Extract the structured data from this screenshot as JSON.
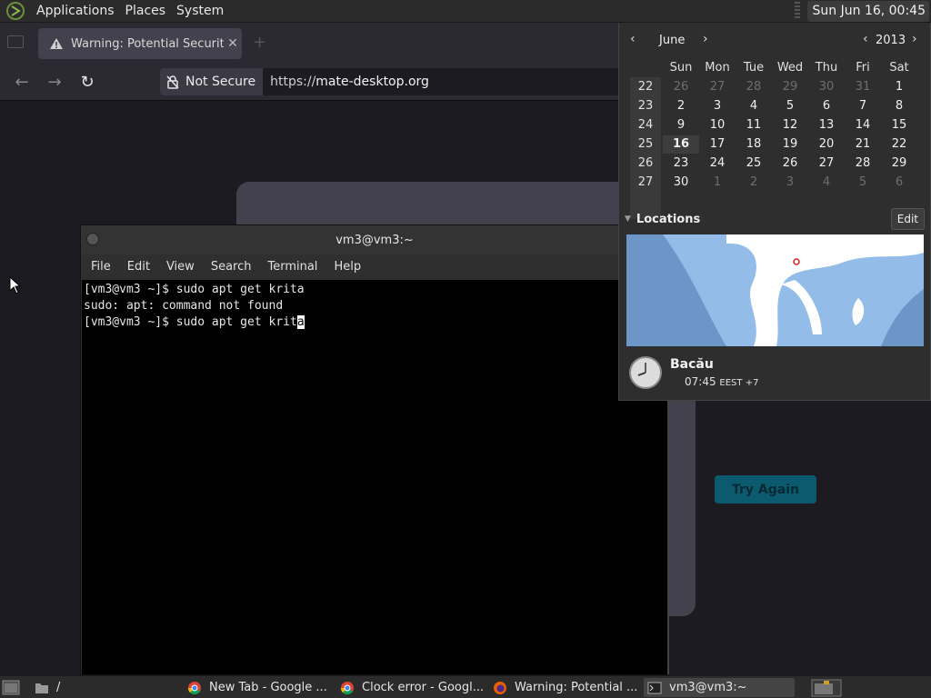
{
  "top_panel": {
    "menus": [
      "Applications",
      "Places",
      "System"
    ],
    "clock": "Sun Jun 16, 00:45"
  },
  "browser": {
    "tab_title": "Warning: Potential Security",
    "tab_close": "✕",
    "security_label": "Not Secure",
    "url_scheme": "https://",
    "url_host": "mate-desktop.org",
    "try_again_label": "Try Again"
  },
  "terminal": {
    "title": "vm3@vm3:~",
    "menu": [
      "File",
      "Edit",
      "View",
      "Search",
      "Terminal",
      "Help"
    ],
    "lines": [
      "[vm3@vm3 ~]$ sudo apt get krita",
      "sudo: apt: command not found"
    ],
    "current_prompt": "[vm3@vm3 ~]$ sudo apt get krit",
    "cursor_char": "a"
  },
  "calendar": {
    "month": "June",
    "year": "2013",
    "weekdays": [
      "Sun",
      "Mon",
      "Tue",
      "Wed",
      "Thu",
      "Fri",
      "Sat"
    ],
    "weeks": [
      {
        "num": "22",
        "days": [
          {
            "d": "26",
            "other": true
          },
          {
            "d": "27",
            "other": true
          },
          {
            "d": "28",
            "other": true
          },
          {
            "d": "29",
            "other": true
          },
          {
            "d": "30",
            "other": true
          },
          {
            "d": "31",
            "other": true
          },
          {
            "d": "1"
          }
        ]
      },
      {
        "num": "23",
        "days": [
          {
            "d": "2"
          },
          {
            "d": "3"
          },
          {
            "d": "4"
          },
          {
            "d": "5"
          },
          {
            "d": "6"
          },
          {
            "d": "7"
          },
          {
            "d": "8"
          }
        ]
      },
      {
        "num": "24",
        "days": [
          {
            "d": "9"
          },
          {
            "d": "10"
          },
          {
            "d": "11"
          },
          {
            "d": "12"
          },
          {
            "d": "13"
          },
          {
            "d": "14"
          },
          {
            "d": "15"
          }
        ]
      },
      {
        "num": "25",
        "days": [
          {
            "d": "16",
            "today": true
          },
          {
            "d": "17"
          },
          {
            "d": "18"
          },
          {
            "d": "19"
          },
          {
            "d": "20"
          },
          {
            "d": "21"
          },
          {
            "d": "22"
          }
        ]
      },
      {
        "num": "26",
        "days": [
          {
            "d": "23"
          },
          {
            "d": "24"
          },
          {
            "d": "25"
          },
          {
            "d": "26"
          },
          {
            "d": "27"
          },
          {
            "d": "28"
          },
          {
            "d": "29"
          }
        ]
      },
      {
        "num": "27",
        "days": [
          {
            "d": "30"
          },
          {
            "d": "1",
            "other": true
          },
          {
            "d": "2",
            "other": true
          },
          {
            "d": "3",
            "other": true
          },
          {
            "d": "4",
            "other": true
          },
          {
            "d": "5",
            "other": true
          },
          {
            "d": "6",
            "other": true
          }
        ]
      }
    ],
    "locations_label": "Locations",
    "edit_label": "Edit",
    "location": {
      "city": "Bacău",
      "time": "07:45",
      "tz": "EEST +7"
    }
  },
  "taskbar": {
    "items": [
      {
        "label": "/",
        "icon": "folder-icon"
      },
      {
        "label": "New Tab - Google ...",
        "icon": "chrome-icon"
      },
      {
        "label": "Clock error - Googl...",
        "icon": "chrome-icon"
      },
      {
        "label": "Warning: Potential ...",
        "icon": "firefox-icon"
      },
      {
        "label": "vm3@vm3:~",
        "icon": "terminal-icon",
        "active": true
      }
    ]
  },
  "colors": {
    "accent": "#0b5a6e",
    "terminal_bg": "#000000",
    "panel_bg": "#2b2b2b"
  }
}
